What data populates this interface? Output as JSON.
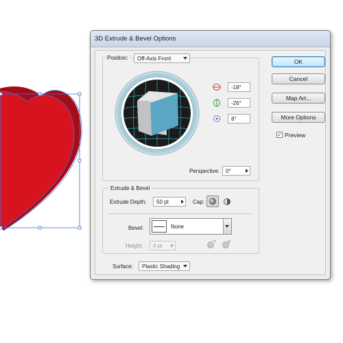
{
  "dialog": {
    "title": "3D Extrude & Bevel Options"
  },
  "position": {
    "label": "Position:",
    "value": "Off-Axis Front",
    "rotation_x": "-18°",
    "rotation_y": "-26°",
    "rotation_z": "8°",
    "perspective_label": "Perspective:",
    "perspective_value": "0°"
  },
  "extrude": {
    "group_title": "Extrude & Bevel",
    "depth_label": "Extrude Depth:",
    "depth_value": "50 pt",
    "cap_label": "Cap:",
    "bevel_label": "Bevel:",
    "bevel_value": "None",
    "height_label": "Height:",
    "height_value": "4 pt"
  },
  "surface": {
    "label": "Surface:",
    "value": "Plastic Shading"
  },
  "buttons": {
    "ok": "OK",
    "cancel": "Cancel",
    "map_art": "Map Art...",
    "more_options": "More Options"
  },
  "preview": {
    "label": "Preview",
    "checked": true,
    "check_mark": "✓"
  },
  "colors": {
    "heart_red": "#d7131f",
    "cube_front": "#5aa7c4",
    "track_grid": "#2fc7d6",
    "selection_blue": "#4a6fd8"
  }
}
